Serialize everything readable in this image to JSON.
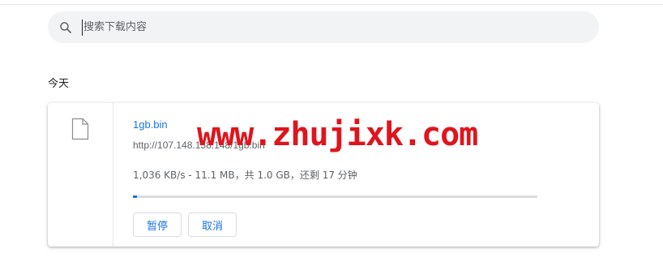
{
  "search": {
    "placeholder": "搜索下载内容",
    "icon": "search-icon"
  },
  "section": {
    "heading": "今天"
  },
  "download": {
    "file_icon": "file-icon",
    "file_name": "1gb.bin",
    "url": "http://107.148.158.148/1gb.bin",
    "status": "1,036 KB/s - 11.1 MB，共 1.0 GB，还剩 17 分钟",
    "progress_fraction": 0.011,
    "pause_label": "暂停",
    "cancel_label": "取消"
  },
  "watermark": {
    "text": "www.zhujixk.com",
    "color": "#e0141c"
  },
  "colors": {
    "accent": "#1a73e8",
    "search_bg": "#f1f3f4",
    "progress_track": "#dadce0"
  }
}
